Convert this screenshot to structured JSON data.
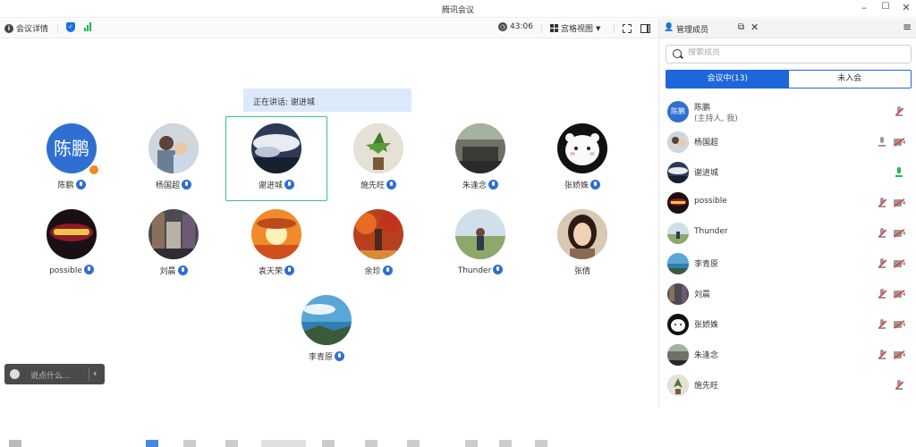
{
  "window": {
    "title": "腾讯会议"
  },
  "toolbar": {
    "meeting_details": "会议详情",
    "timer": "43:06",
    "view_mode": "宫格视图"
  },
  "speaking": {
    "text": "正在讲话: 谢进城"
  },
  "gallery": [
    {
      "name": "陈鹏",
      "avatar_text": "陈鹏",
      "avatar_color": "#2f6fd1",
      "host": true,
      "mic": true
    },
    {
      "name": "杨国超",
      "mic": true,
      "photo": "family"
    },
    {
      "name": "谢进城",
      "mic": true,
      "active": true,
      "photo": "clouds"
    },
    {
      "name": "施先旺",
      "mic": true,
      "photo": "plant"
    },
    {
      "name": "朱逢念",
      "mic": true,
      "photo": "room"
    },
    {
      "name": "张娇姝",
      "mic": true,
      "photo": "bear"
    },
    {
      "name": "possible",
      "mic": true,
      "photo": "astronomy"
    },
    {
      "name": "刘晨",
      "mic": true,
      "photo": "street"
    },
    {
      "name": "袁天荣",
      "mic": true,
      "photo": "sunset"
    },
    {
      "name": "余珍",
      "mic": true,
      "photo": "autumn"
    },
    {
      "name": "Thunder",
      "mic": true,
      "photo": "landscape"
    },
    {
      "name": "张倩",
      "mic": false,
      "photo": "portrait"
    },
    {
      "name": "李青原",
      "mic": true,
      "photo": "coast"
    }
  ],
  "chat": {
    "placeholder": "说点什么..."
  },
  "panel": {
    "title": "管理成员",
    "search_placeholder": "搜索成员",
    "tab_in_meeting": "会议中(13)",
    "tab_not_joined": "未入会",
    "members": [
      {
        "name": "陈鹏",
        "sub": "(主持人, 我)",
        "avatar_text": "陈鹏",
        "mic": "muted",
        "cam": "none"
      },
      {
        "name": "杨国超",
        "mic": "idle",
        "cam": "off"
      },
      {
        "name": "谢进城",
        "mic": "active",
        "cam": "none"
      },
      {
        "name": "possible",
        "mic": "muted",
        "cam": "off"
      },
      {
        "name": "Thunder",
        "mic": "muted",
        "cam": "off"
      },
      {
        "name": "李青原",
        "mic": "muted",
        "cam": "off"
      },
      {
        "name": "刘晨",
        "mic": "muted",
        "cam": "off"
      },
      {
        "name": "张娇姝",
        "mic": "muted",
        "cam": "off"
      },
      {
        "name": "朱逢念",
        "mic": "muted",
        "cam": "off"
      },
      {
        "name": "施先旺",
        "mic": "muted",
        "cam": "none"
      }
    ]
  },
  "colors": {
    "accent": "#1d66dc",
    "speaking_bg": "#dbe9fb",
    "active_border": "#3bc27a",
    "mic_active": "#1fb75c",
    "muted": "#e04848"
  }
}
